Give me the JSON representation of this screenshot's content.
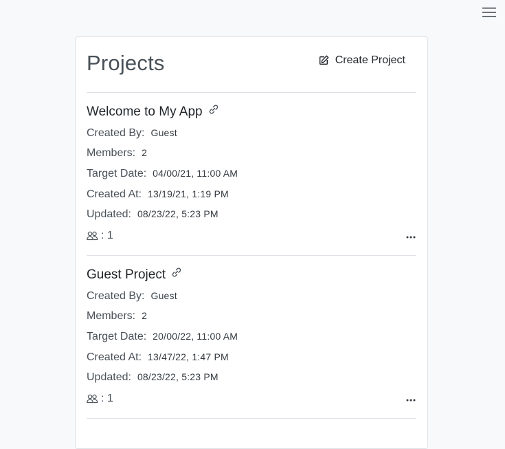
{
  "page": {
    "title": "Projects",
    "create_label": "Create Project"
  },
  "labels": {
    "created_by": "Created By:",
    "members": "Members:",
    "target_date": "Target Date:",
    "created_at": "Created At:",
    "updated": "Updated:"
  },
  "projects": [
    {
      "name": "Welcome to My App",
      "created_by": "Guest",
      "members": "2",
      "target_date": "04/00/21, 11:00 AM",
      "created_at": "13/19/21, 1:19 PM",
      "updated": "08/23/22, 5:23 PM",
      "groups_count": ": 1"
    },
    {
      "name": "Guest Project",
      "created_by": "Guest",
      "members": "2",
      "target_date": "20/00/22, 11:00 AM",
      "created_at": "13/47/22, 1:47 PM",
      "updated": "08/23/22, 5:23 PM",
      "groups_count": ": 1"
    }
  ],
  "icons": {
    "menu": "hamburger-menu-icon",
    "create": "edit-square-icon",
    "link": "link-icon",
    "groups": "people-icon",
    "more": "ellipsis-icon"
  }
}
